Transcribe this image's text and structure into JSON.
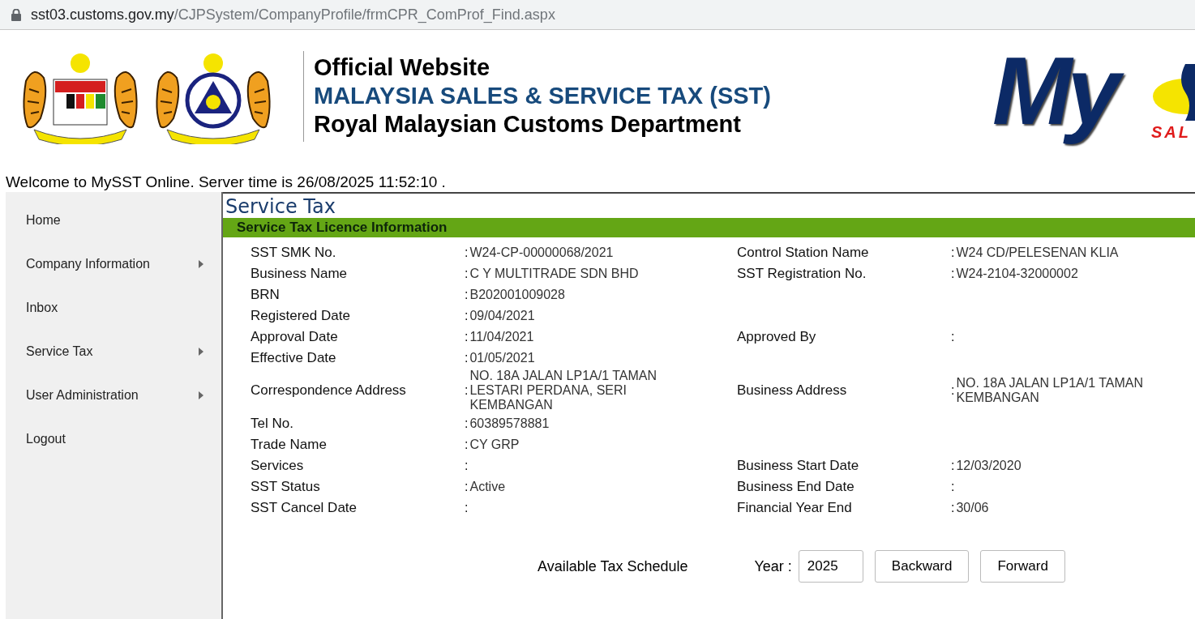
{
  "address_bar": {
    "host": "sst03.customs.gov.my",
    "path": "/CJPSystem/CompanyProfile/frmCPR_ComProf_Find.aspx"
  },
  "header": {
    "title": "Official Website",
    "subtitle": "MALAYSIA SALES & SERVICE TAX (SST)",
    "department": "Royal Malaysian Customs Department",
    "logo": {
      "text": "My",
      "tagline": "SAL"
    }
  },
  "welcome": "Welcome to MySST Online. Server time is 26/08/2025 11:52:10 .",
  "sidebar": {
    "items": [
      {
        "label": "Home",
        "has_submenu": false
      },
      {
        "label": "Company Information",
        "has_submenu": true
      },
      {
        "label": "Inbox",
        "has_submenu": false
      },
      {
        "label": "Service Tax",
        "has_submenu": true
      },
      {
        "label": "User Administration",
        "has_submenu": true
      },
      {
        "label": "Logout",
        "has_submenu": false
      }
    ]
  },
  "content": {
    "title": "Service Tax",
    "section": "Service Tax Licence Information",
    "rows": [
      {
        "left": {
          "label": "SST SMK No.",
          "colon": ":",
          "value": [
            "W24-CP-00000068/2021"
          ]
        },
        "right": {
          "label": "Control Station Name",
          "colon": ":",
          "value": [
            "W24  CD/PELESENAN KLIA"
          ]
        }
      },
      {
        "left": {
          "label": "Business Name",
          "colon": ":",
          "value": [
            "C Y MULTITRADE SDN BHD"
          ]
        },
        "right": {
          "label": "SST Registration No.",
          "colon": ":",
          "value": [
            "W24-2104-32000002"
          ]
        }
      },
      {
        "left": {
          "label": "BRN",
          "colon": ":",
          "value": [
            "B202001009028"
          ]
        }
      },
      {
        "left": {
          "label": "Registered Date",
          "colon": ":",
          "value": [
            "09/04/2021"
          ]
        }
      },
      {
        "left": {
          "label": "Approval Date",
          "colon": ":",
          "value": [
            "11/04/2021"
          ]
        },
        "right": {
          "label": "Approved By",
          "colon": ":"
        }
      },
      {
        "left": {
          "label": "Effective Date",
          "colon": ":",
          "value": [
            "01/05/2021"
          ]
        }
      },
      {
        "left": {
          "label": "Correspondence Address",
          "colon": ":",
          "value": [
            "NO. 18A JALAN LP1A/1 TAMAN",
            "LESTARI PERDANA, SERI",
            "KEMBANGAN"
          ]
        },
        "right": {
          "label": "Business Address",
          "colon": ":",
          "value": [
            "NO. 18A JALAN LP1A/1 TAMAN",
            "KEMBANGAN"
          ]
        }
      },
      {
        "left": {
          "label": "Tel No.",
          "colon": ":",
          "value": [
            " 60389578881"
          ]
        }
      },
      {
        "left": {
          "label": "Trade Name",
          "colon": ":",
          "value": [
            "CY GRP"
          ]
        }
      },
      {
        "left": {
          "label": "Services",
          "colon": ":"
        },
        "right": {
          "label": "Business Start Date",
          "colon": ":",
          "value": [
            "12/03/2020"
          ]
        }
      },
      {
        "left": {
          "label": "SST Status",
          "colon": ":",
          "value": [
            "Active"
          ]
        },
        "right": {
          "label": "Business End Date",
          "colon": ":"
        }
      },
      {
        "left": {
          "label": "SST Cancel Date",
          "colon": ":"
        },
        "right": {
          "label": "Financial Year End",
          "colon": ":",
          "value": [
            "30/06"
          ]
        }
      }
    ],
    "schedule": {
      "label": "Available Tax Schedule",
      "year_label": "Year :",
      "year": "2025",
      "buttons": [
        "Backward",
        "Forward"
      ]
    }
  }
}
